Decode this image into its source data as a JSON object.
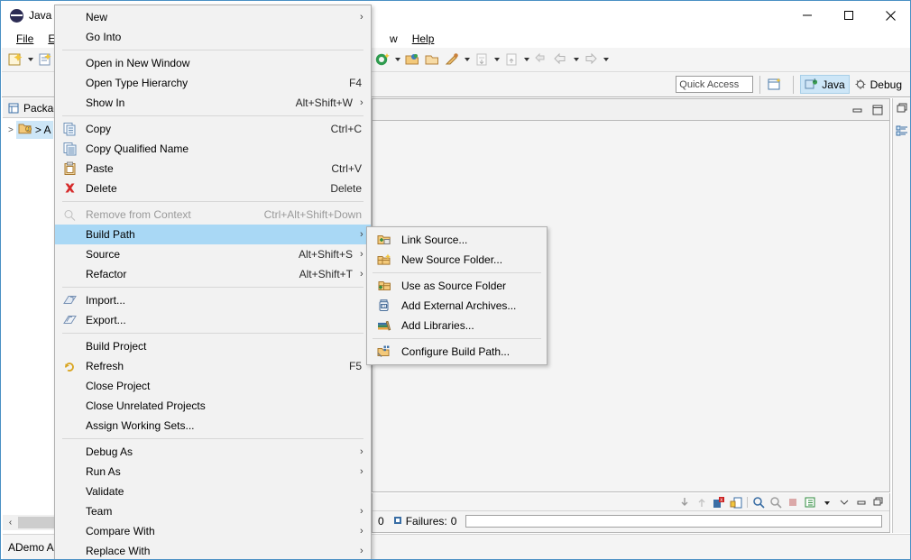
{
  "window": {
    "title": "Java -",
    "logo_icon": "eclipse-logo-icon",
    "minimize_label": "Minimize",
    "maximize_label": "Maximize",
    "close_label": "Close"
  },
  "menubar": {
    "items": [
      {
        "label": "File",
        "mnemonic": "F"
      },
      {
        "label": "Edit",
        "mnemonic": "E"
      },
      {
        "label": "w",
        "mnemonic": ""
      },
      {
        "label": "Help",
        "mnemonic": "H"
      }
    ]
  },
  "toolbar2": {
    "quick_access_placeholder": "Quick Access",
    "quick_access_value": "",
    "open_perspective_icon": "open-perspective-icon",
    "perspectives": [
      {
        "label": "Java",
        "icon": "java-perspective-icon",
        "active": true
      },
      {
        "label": "Debug",
        "icon": "debug-perspective-icon",
        "active": false
      }
    ]
  },
  "left_view": {
    "tab_label": "Packag",
    "tab_icon": "package-explorer-icon",
    "tree": [
      {
        "twisty": ">",
        "icon": "java-project-icon",
        "label": "> A",
        "selected": true
      }
    ]
  },
  "bottom_view": {
    "failures_label": "Failures:",
    "failures_count": "0",
    "truncated_count": "0",
    "toolbar_icons": [
      "next-failure-icon",
      "previous-failure-icon",
      "show-failures-only-icon",
      "lock-icon",
      "rerun-test-icon",
      "rerun-failed-icon",
      "stop-icon",
      "test-history-icon",
      "view-menu-icon",
      "minimize-icon",
      "maximize-icon"
    ]
  },
  "statusbar": {
    "text": "ADemo Ap"
  },
  "context_menu": {
    "name": "project-context-menu",
    "items": [
      {
        "label": "New",
        "accel": "",
        "submenu": true,
        "icon": null,
        "disabled": false,
        "highlight": false
      },
      {
        "label": "Go Into",
        "accel": "",
        "submenu": false,
        "icon": null,
        "disabled": false,
        "highlight": false
      },
      {
        "separator": true
      },
      {
        "label": "Open in New Window",
        "accel": "",
        "submenu": false,
        "icon": null,
        "disabled": false,
        "highlight": false
      },
      {
        "label": "Open Type Hierarchy",
        "accel": "F4",
        "submenu": false,
        "icon": null,
        "disabled": false,
        "highlight": false
      },
      {
        "label": "Show In",
        "accel": "Alt+Shift+W",
        "submenu": true,
        "icon": null,
        "disabled": false,
        "highlight": false
      },
      {
        "separator": true
      },
      {
        "label": "Copy",
        "accel": "Ctrl+C",
        "submenu": false,
        "icon": "copy-icon",
        "disabled": false,
        "highlight": false
      },
      {
        "label": "Copy Qualified Name",
        "accel": "",
        "submenu": false,
        "icon": "copy-qualified-name-icon",
        "disabled": false,
        "highlight": false
      },
      {
        "label": "Paste",
        "accel": "Ctrl+V",
        "submenu": false,
        "icon": "paste-icon",
        "disabled": false,
        "highlight": false
      },
      {
        "label": "Delete",
        "accel": "Delete",
        "submenu": false,
        "icon": "delete-icon",
        "disabled": false,
        "highlight": false
      },
      {
        "separator": true
      },
      {
        "label": "Remove from Context",
        "accel": "Ctrl+Alt+Shift+Down",
        "submenu": false,
        "icon": "remove-from-context-icon",
        "disabled": true,
        "highlight": false
      },
      {
        "label": "Build Path",
        "accel": "",
        "submenu": true,
        "icon": null,
        "disabled": false,
        "highlight": true
      },
      {
        "label": "Source",
        "accel": "Alt+Shift+S",
        "submenu": true,
        "icon": null,
        "disabled": false,
        "highlight": false
      },
      {
        "label": "Refactor",
        "accel": "Alt+Shift+T",
        "submenu": true,
        "icon": null,
        "disabled": false,
        "highlight": false
      },
      {
        "separator": true
      },
      {
        "label": "Import...",
        "accel": "",
        "submenu": false,
        "icon": "import-icon",
        "disabled": false,
        "highlight": false
      },
      {
        "label": "Export...",
        "accel": "",
        "submenu": false,
        "icon": "export-icon",
        "disabled": false,
        "highlight": false
      },
      {
        "separator": true
      },
      {
        "label": "Build Project",
        "accel": "",
        "submenu": false,
        "icon": null,
        "disabled": false,
        "highlight": false
      },
      {
        "label": "Refresh",
        "accel": "F5",
        "submenu": false,
        "icon": "refresh-icon",
        "disabled": false,
        "highlight": false
      },
      {
        "label": "Close Project",
        "accel": "",
        "submenu": false,
        "icon": null,
        "disabled": false,
        "highlight": false
      },
      {
        "label": "Close Unrelated Projects",
        "accel": "",
        "submenu": false,
        "icon": null,
        "disabled": false,
        "highlight": false
      },
      {
        "label": "Assign Working Sets...",
        "accel": "",
        "submenu": false,
        "icon": null,
        "disabled": false,
        "highlight": false
      },
      {
        "separator": true
      },
      {
        "label": "Debug As",
        "accel": "",
        "submenu": true,
        "icon": null,
        "disabled": false,
        "highlight": false
      },
      {
        "label": "Run As",
        "accel": "",
        "submenu": true,
        "icon": null,
        "disabled": false,
        "highlight": false
      },
      {
        "label": "Validate",
        "accel": "",
        "submenu": false,
        "icon": null,
        "disabled": false,
        "highlight": false
      },
      {
        "label": "Team",
        "accel": "",
        "submenu": true,
        "icon": null,
        "disabled": false,
        "highlight": false
      },
      {
        "label": "Compare With",
        "accel": "",
        "submenu": true,
        "icon": null,
        "disabled": false,
        "highlight": false
      },
      {
        "label": "Replace With",
        "accel": "",
        "submenu": true,
        "icon": null,
        "disabled": false,
        "highlight": false
      }
    ]
  },
  "submenu": {
    "name": "build-path-submenu",
    "items": [
      {
        "label": "Link Source...",
        "icon": "link-source-icon"
      },
      {
        "label": "New Source Folder...",
        "icon": "new-source-folder-icon"
      },
      {
        "separator": true
      },
      {
        "label": "Use as Source Folder",
        "icon": "use-as-source-folder-icon"
      },
      {
        "label": "Add External Archives...",
        "icon": "add-external-archives-icon"
      },
      {
        "label": "Add Libraries...",
        "icon": "add-libraries-icon"
      },
      {
        "separator": true
      },
      {
        "label": "Configure Build Path...",
        "icon": "configure-build-path-icon"
      }
    ]
  },
  "colors": {
    "menu_highlight": "#a9d8f5",
    "menu_background": "#f2f2f2",
    "perspective_active": "#cde6f7",
    "tree_selection": "#cde6f7",
    "window_border": "#4a90c4"
  }
}
